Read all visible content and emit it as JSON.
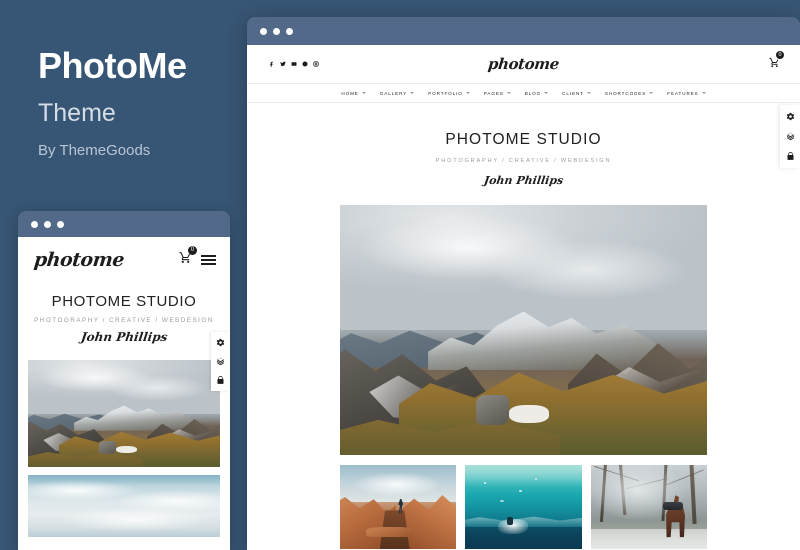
{
  "promo": {
    "title": "PhotoMe",
    "subtitle": "Theme",
    "byline": "By ThemeGoods",
    "background_color": "#375574"
  },
  "browser_chrome": {
    "dots": [
      "close-dot",
      "minimize-dot",
      "maximize-dot"
    ],
    "bar_color": "#52698a"
  },
  "mobile_window": {
    "logo": "photome",
    "cart_count": "0",
    "menu_icon": "hamburger-menu-icon",
    "hero": {
      "title": "PHOTOME STUDIO",
      "subtitle": "PHOTOGRAPHY / CREATIVE / WEBDESIGN",
      "signature": "John Phillips"
    },
    "side_tools": [
      {
        "name": "settings-icon",
        "label": "Settings"
      },
      {
        "name": "layers-icon",
        "label": "Layers"
      },
      {
        "name": "cart-tool-icon",
        "label": "Purchase"
      }
    ],
    "photos": [
      {
        "name": "mountain-photo",
        "alt": "Snowy mountain ridge with golden grass"
      },
      {
        "name": "sky-photo",
        "alt": "Clouded sky over water"
      }
    ]
  },
  "desktop_window": {
    "logo": "photome",
    "cart_count": "0",
    "social_links": [
      {
        "name": "facebook-icon",
        "label": "Facebook"
      },
      {
        "name": "twitter-icon",
        "label": "Twitter"
      },
      {
        "name": "vimeo-icon",
        "label": "Vimeo"
      },
      {
        "name": "pinterest-icon",
        "label": "Pinterest"
      },
      {
        "name": "instagram-icon",
        "label": "Instagram"
      }
    ],
    "nav_items": [
      {
        "label": "HOME",
        "has_dropdown": true
      },
      {
        "label": "GALLERY",
        "has_dropdown": true
      },
      {
        "label": "PORTFOLIO",
        "has_dropdown": true
      },
      {
        "label": "PAGES",
        "has_dropdown": true
      },
      {
        "label": "BLOG",
        "has_dropdown": true
      },
      {
        "label": "CLIENT",
        "has_dropdown": true
      },
      {
        "label": "SHORTCODES",
        "has_dropdown": true
      },
      {
        "label": "FEATURES",
        "has_dropdown": true
      }
    ],
    "hero": {
      "title": "PHOTOME STUDIO",
      "subtitle": "PHOTOGRAPHY / CREATIVE / WEBDESIGN",
      "signature": "John Phillips"
    },
    "hero_photo": {
      "name": "mountain-photo",
      "alt": "Snowy mountain ridge with golden grass"
    },
    "thumbnails": [
      {
        "name": "canyon-photo",
        "alt": "Person leaping over red canyon rocks"
      },
      {
        "name": "ocean-photo",
        "alt": "Surfer on turquoise ocean"
      },
      {
        "name": "forest-photo",
        "alt": "Horse in snowy winter forest"
      }
    ],
    "side_tools": [
      {
        "name": "settings-icon",
        "label": "Settings"
      },
      {
        "name": "layers-icon",
        "label": "Layers"
      },
      {
        "name": "cart-tool-icon",
        "label": "Purchase"
      }
    ]
  }
}
